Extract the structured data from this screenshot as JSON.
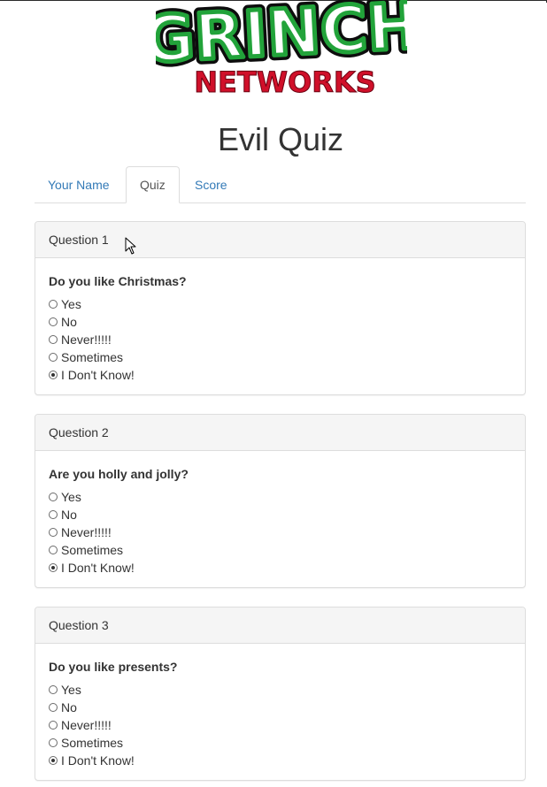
{
  "logo": {
    "word": "GRINCH",
    "subword": "NETWORKS"
  },
  "page_title": "Evil Quiz",
  "tabs": [
    {
      "label": "Your Name",
      "active": false
    },
    {
      "label": "Quiz",
      "active": true
    },
    {
      "label": "Score",
      "active": false
    }
  ],
  "questions": [
    {
      "heading": "Question 1",
      "text": "Do you like Christmas?",
      "options": [
        "Yes",
        "No",
        "Never!!!!!",
        "Sometimes",
        "I Don't Know!"
      ],
      "selected": 4
    },
    {
      "heading": "Question 2",
      "text": "Are you holly and jolly?",
      "options": [
        "Yes",
        "No",
        "Never!!!!!",
        "Sometimes",
        "I Don't Know!"
      ],
      "selected": 4
    },
    {
      "heading": "Question 3",
      "text": "Do you like presents?",
      "options": [
        "Yes",
        "No",
        "Never!!!!!",
        "Sometimes",
        "I Don't Know!"
      ],
      "selected": 4
    }
  ],
  "colors": {
    "link": "#337ab7",
    "logo_green": "#22a33a",
    "logo_red": "#d0102a"
  }
}
